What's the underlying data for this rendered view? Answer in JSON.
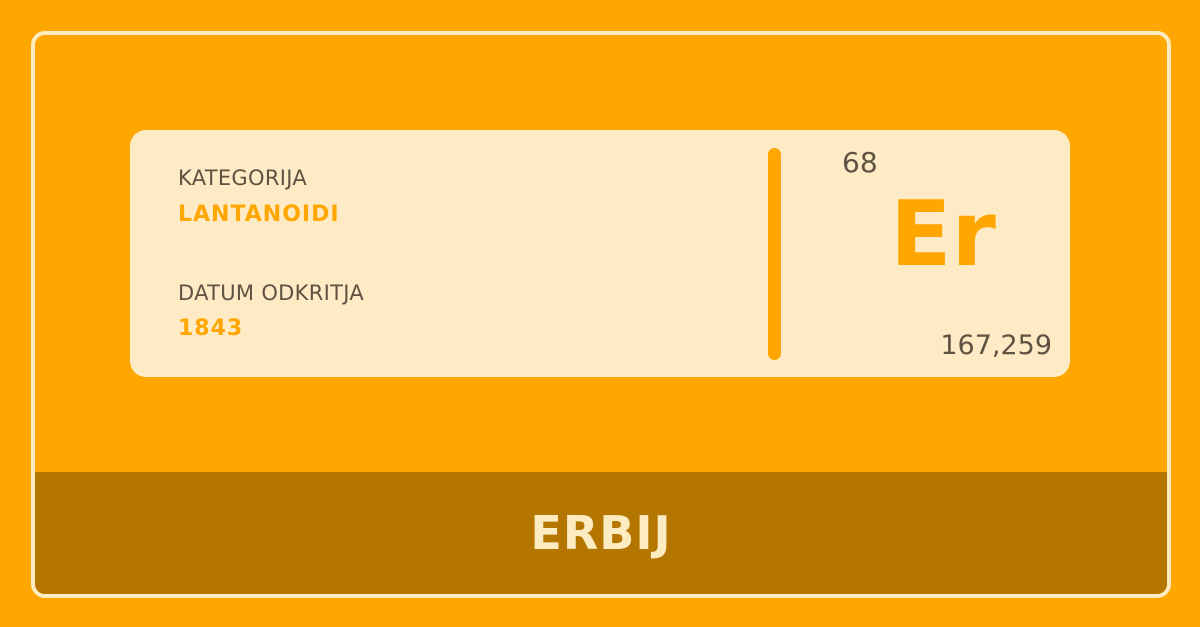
{
  "element": {
    "category_label": "KATEGORIJA",
    "category": "LANTANOIDI",
    "discovery_label": "DATUM ODKRITJA",
    "discovery_year": "1843",
    "atomic_number": "68",
    "symbol": "Er",
    "atomic_mass": "167,259",
    "name": "ERBIJ"
  },
  "colors": {
    "background": "#FFA600",
    "card": "#FEEBC5",
    "name_bar": "#B57600",
    "text_dark": "#5F5243",
    "text_light": "#FDEBC2"
  }
}
